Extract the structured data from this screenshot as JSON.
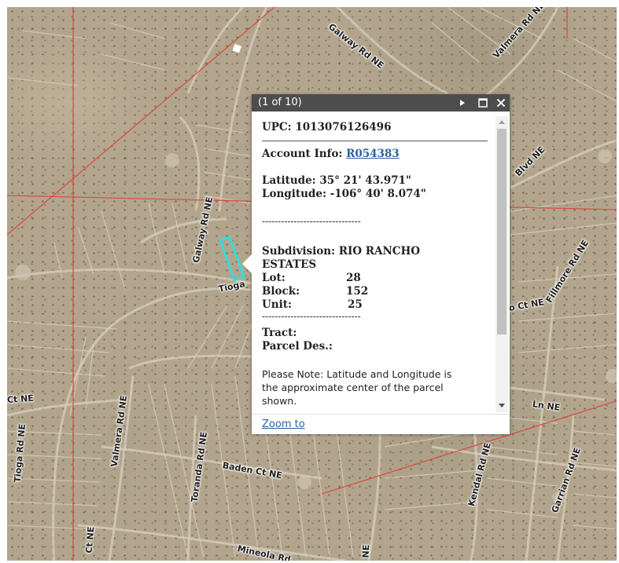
{
  "map": {
    "road_labels": [
      "Galway Rd NE",
      "Valmera Rd NE",
      "Galway Rd NE",
      "Tioga",
      "Fillmore Rd NE",
      "Blvd NE",
      "o Ct NE",
      "Ct NE",
      "Valmera Rd NE",
      "Tioga Rd NE",
      "Toranda Rd NE",
      "Baden Ct NE",
      "Kendal Rd NE",
      "Garrian Rd NE",
      "Ct NE",
      "Mineola Rd",
      "Ln NE",
      "NE"
    ],
    "selected_parcel_color": "#33dddd",
    "section_line_color": "#e0403a"
  },
  "popup": {
    "count_label": "(1 of 10)",
    "upc": "UPC: 1013076126496",
    "account_label": "Account Info: ",
    "account_link": "R054383",
    "latitude": "Latitude: 35° 21' 43.971\"",
    "longitude": "Longitude: -106° 40' 8.074\"",
    "separator": "-------------------------------",
    "subdivision_line1": "Subdivision: RIO RANCHO",
    "subdivision_line2": "ESTATES",
    "lot_label": "Lot:",
    "lot_value": "28",
    "block_label": "Block:",
    "block_value": "152",
    "unit_label": "Unit:",
    "unit_value": "25",
    "separator2": "-------------------------------",
    "tract": "Tract:",
    "parcel_des": "Parcel Des.:",
    "note_line1": "Please Note: Latitude and Longitude is",
    "note_line2": "the approximate center of the parcel",
    "note_line3": "shown.",
    "zoom_to": "Zoom to",
    "icons": [
      "next-arrow-icon",
      "maximize-icon",
      "close-icon"
    ]
  }
}
